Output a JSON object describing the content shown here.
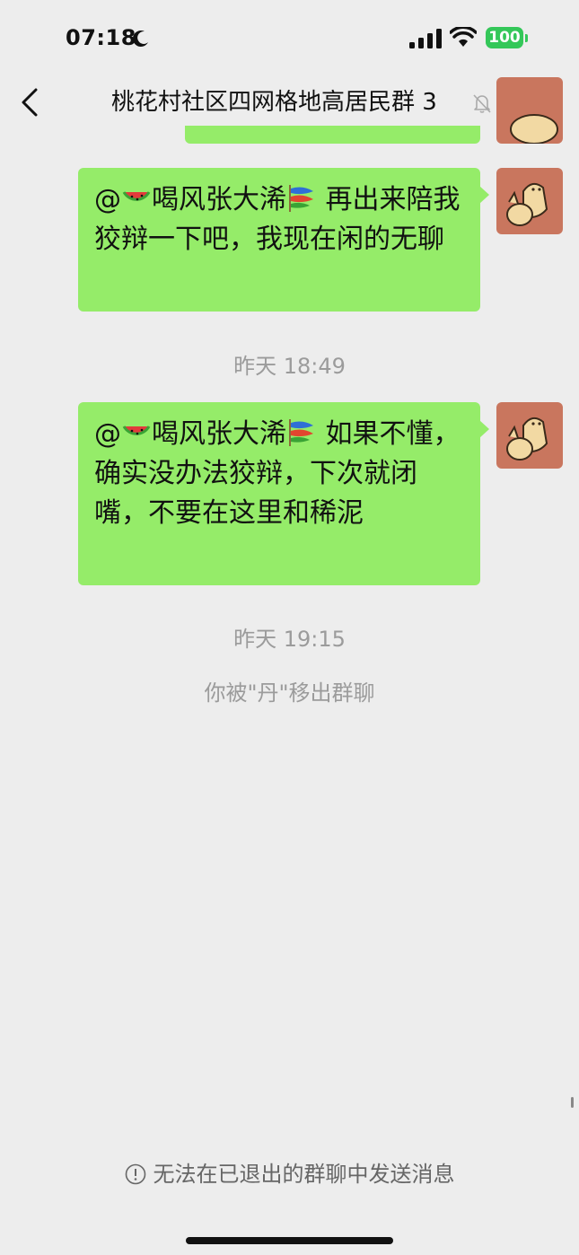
{
  "status_bar": {
    "time": "07:18",
    "battery": "100"
  },
  "nav": {
    "title": "桃花村社区四网格地高居民群 3"
  },
  "messages": [
    {
      "mention": "@",
      "name": "喝风张大浠",
      "text_line1": "再出来",
      "text_rest": "陪我狡辩一下吧，我现在闲的无聊"
    },
    {
      "mention": "@",
      "name": "喝风张大浠",
      "text_line1": "如果不",
      "text_rest": "懂，确实没办法狡辩，下次就闭嘴，不要在这里和稀泥"
    }
  ],
  "timestamps": {
    "t1": "昨天 18:49",
    "t2": "昨天 19:15"
  },
  "system_notice": "你被\"丹\"移出群聊",
  "footer": {
    "note": "无法在已退出的群聊中发送消息"
  },
  "colors": {
    "bubble": "#95ec69",
    "background": "#ededed",
    "battery": "#34c759"
  }
}
